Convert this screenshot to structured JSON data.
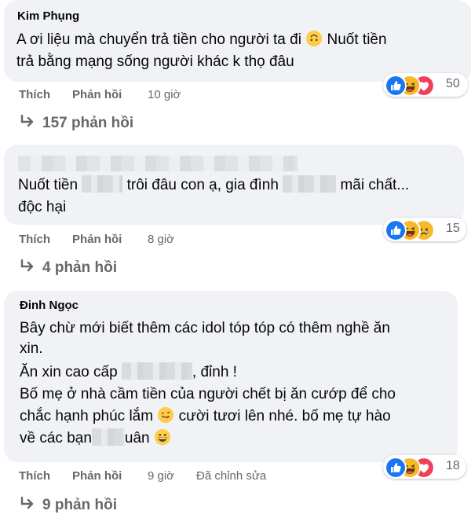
{
  "comments": [
    {
      "author": "Kim Phụng",
      "line1": "A ơi liệu mà chuyển trả tiền cho người ta đi",
      "line1b": "Nuốt tiền",
      "line2": "trả bằng mạng sống người khác k thọ đâu",
      "like": "Thích",
      "reply": "Phản hồi",
      "time": "10 giờ",
      "reaction_count": "50",
      "replies": "157 phản hồi"
    },
    {
      "author": "",
      "line1a": "Nuốt tiền",
      "line1b": "trôi đâu con ạ, gia đình",
      "line1c": "mãi chất...",
      "line2": "độc hại",
      "like": "Thích",
      "reply": "Phản hồi",
      "time": "8 giờ",
      "reaction_count": "15",
      "replies": "4 phản hồi"
    },
    {
      "author": "Đinh Ngọc",
      "line1": "Bây chừ mới biết thêm các idol tóp tóp có thêm nghề ăn",
      "line2": "xin.",
      "line3a": "Ăn xin cao cấp",
      "line3b": ", đỉnh !",
      "line4": "Bố mẹ ở nhà cầm tiền của người chết bị ăn cướp để cho",
      "line5a": "chắc hạnh phúc lắm",
      "line5b": "cười tươi lên nhé. bố mẹ tự hào",
      "line6a": "về các bạn",
      "line6b": "uân",
      "like": "Thích",
      "reply": "Phản hồi",
      "time": "9 giờ",
      "edited": "Đã chỉnh sửa",
      "reaction_count": "18",
      "replies": "9 phản hồi"
    }
  ],
  "colors": {
    "bubble": "#f0f2f5",
    "meta": "#65676b",
    "like_blue": "#1877f2",
    "haha_yellow": "#f7b928",
    "love_red": "#f33e58"
  },
  "icons": [
    "like-icon",
    "haha-icon",
    "love-icon",
    "sad-icon",
    "reply-arrow-icon",
    "upside-down-face-emoji",
    "tongue-wink-emoji",
    "grin-emoji"
  ]
}
